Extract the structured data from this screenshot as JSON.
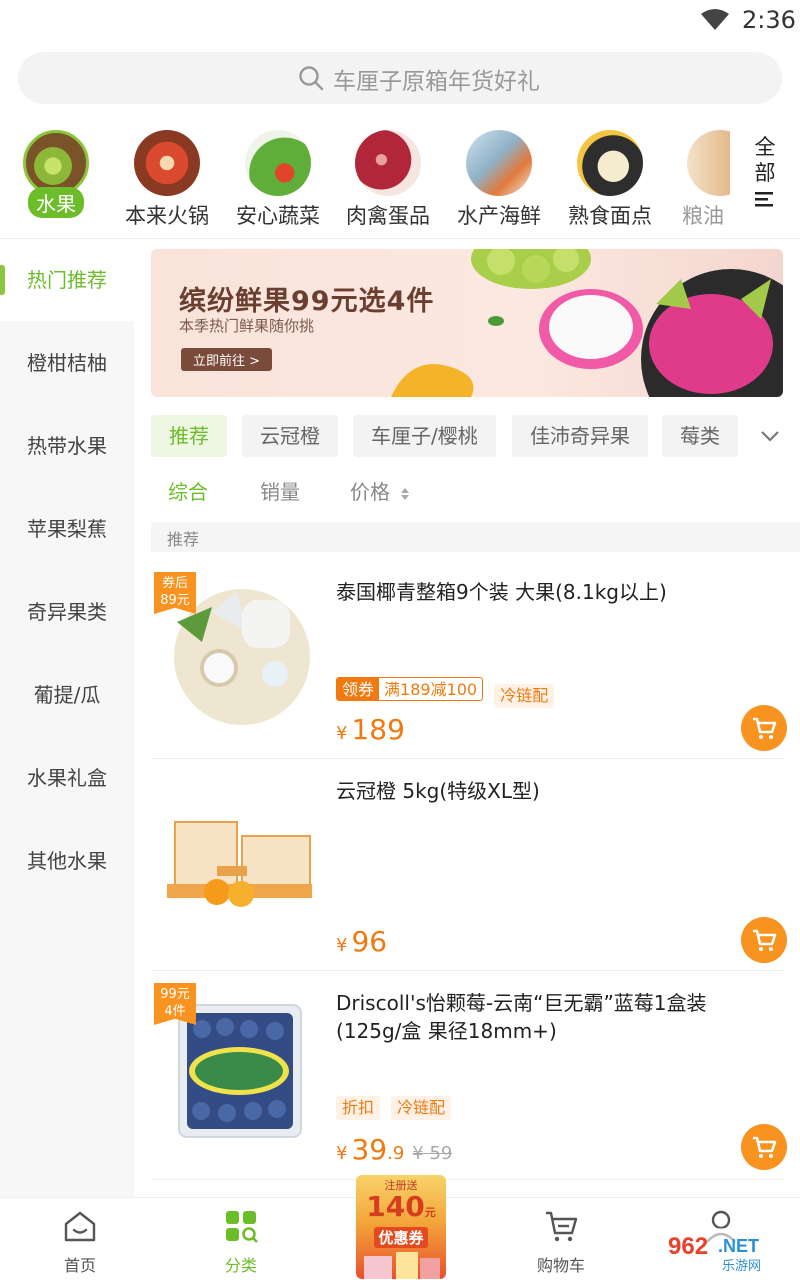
{
  "status_bar": {
    "time": "2:36"
  },
  "search": {
    "placeholder": "车厘子原箱年货好礼"
  },
  "categories": [
    {
      "label": "水果",
      "icon": "kiwi-fruit-image",
      "active": true
    },
    {
      "label": "本来火锅",
      "icon": "hotpot-image"
    },
    {
      "label": "安心蔬菜",
      "icon": "vegetables-image"
    },
    {
      "label": "肉禽蛋品",
      "icon": "meat-image"
    },
    {
      "label": "水产海鲜",
      "icon": "seafood-image"
    },
    {
      "label": "熟食面点",
      "icon": "dumplings-image"
    },
    {
      "label": "粮油",
      "icon": "grain-oil-image"
    }
  ],
  "categories_all": {
    "line1": "全",
    "line2": "部"
  },
  "sidebar": {
    "items": [
      {
        "label": "热门推荐",
        "active": true
      },
      {
        "label": "橙柑桔柚"
      },
      {
        "label": "热带水果"
      },
      {
        "label": "苹果梨蕉"
      },
      {
        "label": "奇异果类"
      },
      {
        "label": "葡提/瓜"
      },
      {
        "label": "水果礼盒"
      },
      {
        "label": "其他水果"
      }
    ]
  },
  "banner": {
    "title": "缤纷鲜果99元选4件",
    "subtitle": "本季热门鲜果随你挑",
    "button": "立即前往 >"
  },
  "tabs": [
    {
      "label": "推荐",
      "active": true
    },
    {
      "label": "云冠橙"
    },
    {
      "label": "车厘子/樱桃"
    },
    {
      "label": "佳沛奇异果"
    },
    {
      "label": "莓类"
    }
  ],
  "sort": {
    "overall": "综合",
    "sales": "销量",
    "price": "价格"
  },
  "section": {
    "title": "推荐"
  },
  "products": [
    {
      "badge_line1": "券后",
      "badge_line2": "89元",
      "title": "泰国椰青整箱9个装 大果(8.1kg以上)",
      "coupon_label": "领券",
      "coupon_text": "满189减100",
      "tag": "冷链配",
      "price_yen": "¥",
      "price": "189"
    },
    {
      "title": "云冠橙 5kg(特级XL型)",
      "price_yen": "¥",
      "price": "96"
    },
    {
      "badge_line1": "99元",
      "badge_line2": "4件",
      "title": "Driscoll's怡颗莓-云南“巨无霸”蓝莓1盒装(125g/盒 果径18mm+)",
      "tag1": "折扣",
      "tag2": "冷链配",
      "price_yen": "¥",
      "price": "39",
      "price_decimal": ".9",
      "original_price": "¥ 59"
    }
  ],
  "bottom_nav": {
    "home": "首页",
    "category": "分类",
    "cart": "购物车",
    "promo_line1": "注册送",
    "promo_amount": "140",
    "promo_unit": "元",
    "promo_line3": "优惠券"
  },
  "colors": {
    "accent_green": "#6dbd2a",
    "accent_orange": "#f07a10",
    "cart_orange": "#f7931e"
  }
}
